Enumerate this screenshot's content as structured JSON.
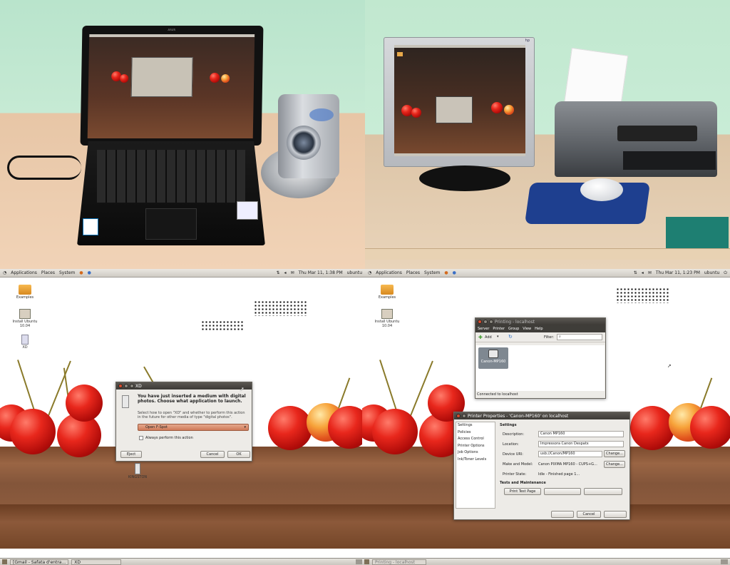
{
  "photo_laptop": {
    "brand": "ASUS"
  },
  "photo_desktop": {
    "brand": "hp"
  },
  "panel_left": {
    "applications": "Applications",
    "places": "Places",
    "system": "System",
    "datetime": "Thu Mar 11, 1:38 PM",
    "user": "ubuntu"
  },
  "panel_right": {
    "applications": "Applications",
    "places": "Places",
    "system": "System",
    "datetime": "Thu Mar 11, 1:23 PM",
    "user": "ubuntu"
  },
  "desktop_left": {
    "icons": {
      "examples": "Examples",
      "install": "Install Ubuntu 10.04",
      "xd": "XD",
      "kingston": "KINGSTON"
    },
    "dialog": {
      "title": "XD",
      "heading": "You have just inserted a medium with digital photos. Choose what application to launch.",
      "body": "Select how to open \"XD\" and whether to perform this action in the future for other media of type \"digital photos\".",
      "app_choice": "Open F-Spot",
      "always": "Always perform this action",
      "eject": "Eject",
      "cancel": "Cancel",
      "ok": "OK"
    },
    "taskbar": {
      "item1": "[Gmail - Safata d'entra...",
      "item2": "XD"
    }
  },
  "desktop_right": {
    "icons": {
      "examples": "Examples",
      "install": "Install Ubuntu 10.04"
    },
    "printing": {
      "title": "Printing - localhost",
      "menu": [
        "Server",
        "Printer",
        "Group",
        "View",
        "Help"
      ],
      "add": "Add",
      "filter_label": "Filter:",
      "printer_name": "Canon-MP160",
      "status": "Connected to localhost"
    },
    "props": {
      "title": "Printer Properties - 'Canon-MP160' on localhost",
      "sidebar": [
        "Settings",
        "Policies",
        "Access Control",
        "Printer Options",
        "Job Options",
        "Ink/Toner Levels"
      ],
      "section": "Settings",
      "description_label": "Description:",
      "description_value": "Canon MP160",
      "location_label": "Location:",
      "location_value": "Impressora Canon Despatx",
      "uri_label": "Device URI:",
      "uri_value": "usb://Canon/MP160",
      "make_label": "Make and Model:",
      "make_value": "Canon PIXMA MP160 - CUPS+G...",
      "state_label": "Printer State:",
      "state_value": "Idle - Finished page 1...",
      "change": "Change...",
      "tests_heading": "Tests and Maintenance",
      "print_test": "Print Test Page",
      "cancel": "Cancel"
    },
    "taskbar": {
      "item1": "Printing - localhost"
    }
  }
}
